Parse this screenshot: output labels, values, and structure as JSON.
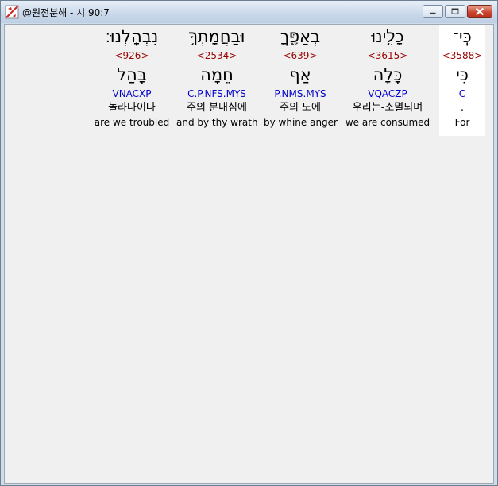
{
  "window": {
    "title": "@원전분해 - 시 90:7"
  },
  "colors": {
    "strong": "#990000",
    "morph": "#0000cc",
    "highlight_bg": "#ffffff"
  },
  "words": [
    {
      "heb": "כִּֽי־",
      "strong": "<3588>",
      "lex": "כִּי",
      "morph": "C",
      "kor": ".",
      "eng": "For"
    },
    {
      "heb": "כָלִ֥ינוּ",
      "strong": "<3615>",
      "lex": "כָּלָה",
      "morph": "VQACZP",
      "kor": "우리는-소멸되며",
      "eng": "we are consumed"
    },
    {
      "heb": "בְאַפֶּ֑ךָ",
      "strong": "<639>",
      "lex": "אַף",
      "morph": "P.NMS.MYS",
      "kor": "주의 노에",
      "eng": "by whine anger"
    },
    {
      "heb": "וּבַחֲמָתְךָ֥",
      "strong": "<2534>",
      "lex": "חֵמָה",
      "morph": "C.P.NFS.MYS",
      "kor": "주의 분내심에",
      "eng": "and by thy wrath"
    },
    {
      "heb": "נִבְהָֽלְנוּ׃",
      "strong": "<926>",
      "lex": "בָּהַל",
      "morph": "VNACXP",
      "kor": "놀라나이다",
      "eng": "are we troubled"
    }
  ]
}
